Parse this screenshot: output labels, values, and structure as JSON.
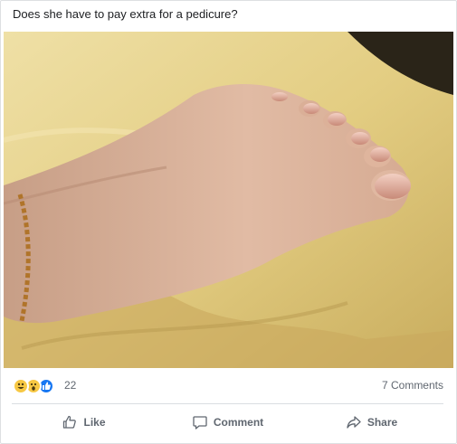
{
  "post": {
    "caption": "Does she have to pay extra for a pedicure?",
    "reactions": {
      "icons": [
        "laugh-icon",
        "wow-icon",
        "like-icon"
      ],
      "count": "22"
    },
    "comments_label": "7 Comments"
  },
  "actions": {
    "like_label": "Like",
    "comment_label": "Comment",
    "share_label": "Share"
  },
  "colors": {
    "text": "#1c1e21",
    "secondary": "#606770",
    "like_blue": "#1877f2",
    "reaction_yellow": "#f7c844"
  }
}
